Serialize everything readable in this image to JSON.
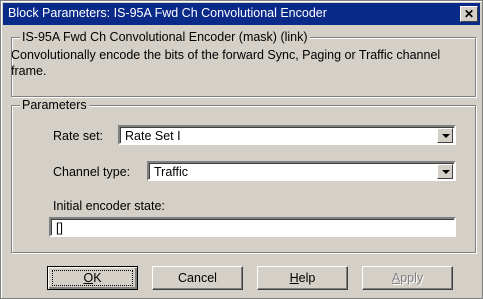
{
  "window": {
    "title": "Block Parameters: IS-95A Fwd Ch Convolutional Encoder",
    "close_glyph": "✕"
  },
  "mask_group": {
    "legend": "IS-95A Fwd Ch Convolutional Encoder (mask) (link)",
    "description": "Convolutionally encode the bits of the forward Sync, Paging or Traffic channel frame."
  },
  "parameters": {
    "legend": "Parameters",
    "rate_set": {
      "label": "Rate set:",
      "value": "Rate Set I"
    },
    "channel_type": {
      "label": "Channel type:",
      "value": "Traffic"
    },
    "initial_state": {
      "label": "Initial encoder state:",
      "value": "[]"
    }
  },
  "buttons": {
    "ok": {
      "label_rest": "K",
      "mnemonic": "O"
    },
    "cancel": {
      "label": "Cancel"
    },
    "help": {
      "mnemonic": "H",
      "label_rest": "elp"
    },
    "apply": {
      "mnemonic": "A",
      "label_rest": "pply"
    }
  },
  "icons": [
    "close-icon",
    "dropdown-arrow-icon"
  ]
}
